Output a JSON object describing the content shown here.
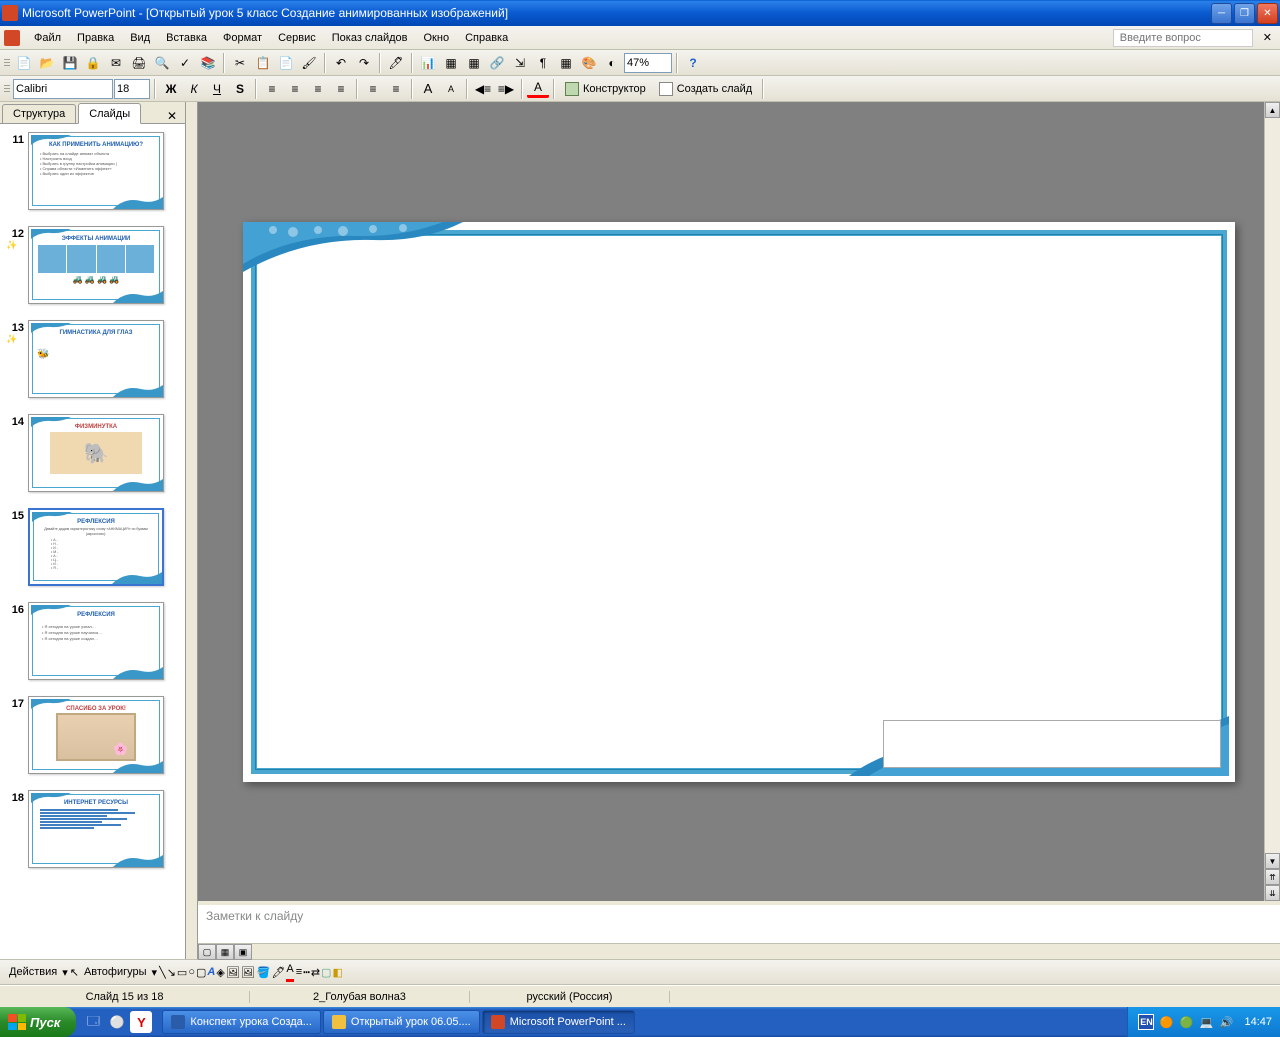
{
  "titlebar": {
    "title": "Microsoft PowerPoint - [Открытый урок 5 класс Создание анимированных изображений]"
  },
  "menu": {
    "file": "Файл",
    "edit": "Правка",
    "view": "Вид",
    "insert": "Вставка",
    "format": "Формат",
    "tools": "Сервис",
    "slideshow": "Показ слайдов",
    "window": "Окно",
    "help": "Справка",
    "question_ph": "Введите вопрос"
  },
  "toolbar": {
    "zoom": "47%"
  },
  "format": {
    "font": "Calibri",
    "size": "18",
    "designer": "Конструктор",
    "newslide": "Создать слайд"
  },
  "tabs": {
    "outline": "Структура",
    "slides": "Слайды"
  },
  "thumbs": [
    {
      "n": "11",
      "title": "КАК ПРИМЕНИТЬ АНИМАЦИЮ?"
    },
    {
      "n": "12",
      "title": "ЭФФЕКТЫ АНИМАЦИИ"
    },
    {
      "n": "13",
      "title": "ГИМНАСТИКА ДЛЯ ГЛАЗ"
    },
    {
      "n": "14",
      "title": "ФИЗМИНУТКА"
    },
    {
      "n": "15",
      "title": "РЕФЛЕКСИЯ"
    },
    {
      "n": "16",
      "title": "РЕФЛЕКСИЯ"
    },
    {
      "n": "17",
      "title": "СПАСИБО ЗА УРОК!"
    },
    {
      "n": "18",
      "title": "ИНТЕРНЕТ РЕСУРСЫ"
    }
  ],
  "slide": {
    "title": "РЕФЛЕКСИЯ",
    "subtitle1": "Давайте дадим характеристику слову «АНИМАЦИЯ» по буквам",
    "subtitle2": "(акрослово):",
    "items": [
      "А  -",
      "Н  -",
      "И  -",
      "М -",
      "А  -",
      "Ц  -",
      "И  -",
      "Я  -"
    ]
  },
  "notes": {
    "ph": "Заметки к слайду"
  },
  "drawbar": {
    "actions": "Действия",
    "autoshapes": "Автофигуры"
  },
  "status": {
    "slide": "Слайд 15 из 18",
    "theme": "2_Голубая волна3",
    "lang": "русский (Россия)"
  },
  "taskbar": {
    "start": "Пуск",
    "tasks": [
      {
        "label": "Конспект урока Созда..."
      },
      {
        "label": "Открытый урок 06.05...."
      },
      {
        "label": "Microsoft PowerPoint ..."
      }
    ],
    "lang": "EN",
    "time": "14:47"
  }
}
